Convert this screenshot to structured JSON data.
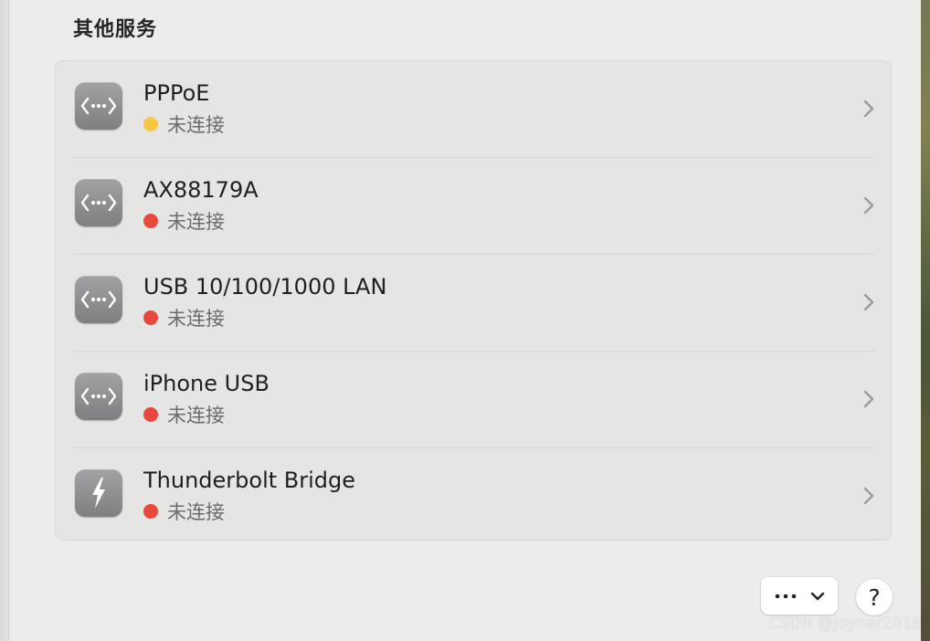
{
  "section": {
    "title": "其他服务"
  },
  "services": [
    {
      "name": "PPPoE",
      "status": "未连接",
      "status_color": "#f6c644",
      "icon": "network-dots-icon"
    },
    {
      "name": "AX88179A",
      "status": "未连接",
      "status_color": "#e9483c",
      "icon": "network-dots-icon"
    },
    {
      "name": "USB 10/100/1000 LAN",
      "status": "未连接",
      "status_color": "#e9483c",
      "icon": "network-dots-icon"
    },
    {
      "name": "iPhone USB",
      "status": "未连接",
      "status_color": "#e9483c",
      "icon": "network-dots-icon"
    },
    {
      "name": "Thunderbolt Bridge",
      "status": "未连接",
      "status_color": "#e9483c",
      "icon": "thunderbolt-icon"
    }
  ],
  "footer": {
    "more_icon": "ellipsis-icon",
    "dropdown_icon": "chevron-down-icon",
    "help_label": "?"
  },
  "watermark": "CSDN @Joyner2018"
}
